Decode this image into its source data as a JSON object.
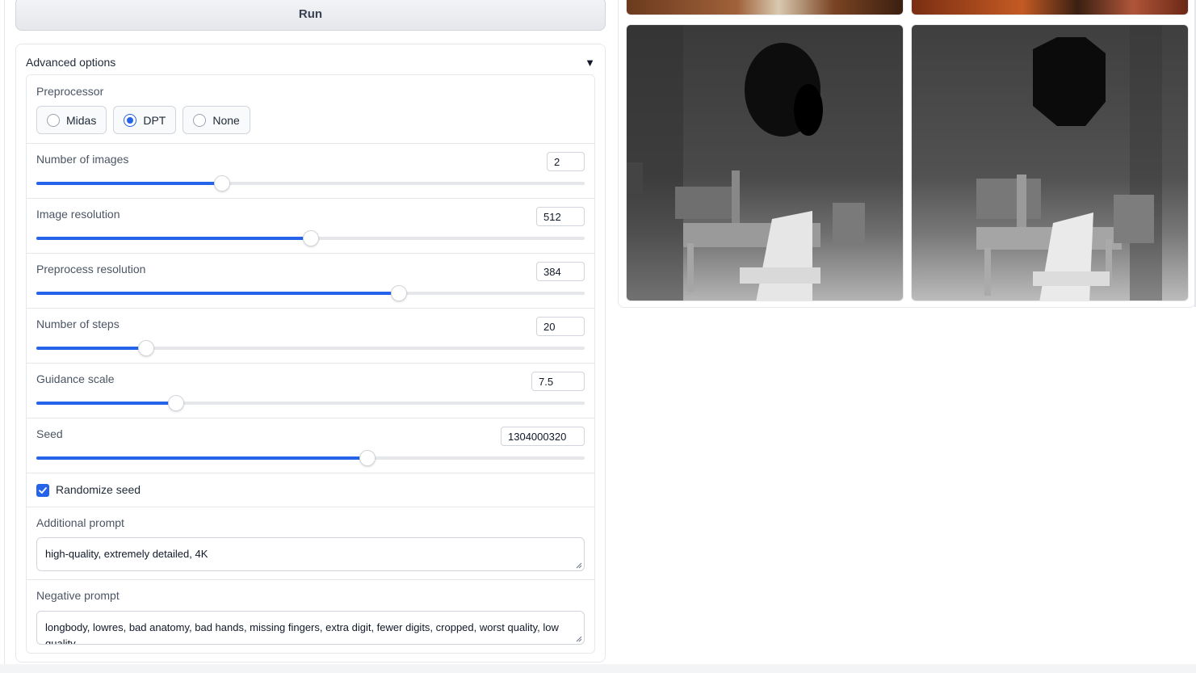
{
  "run_button": {
    "label": "Run"
  },
  "advanced": {
    "title": "Advanced options",
    "caret": "▼",
    "preprocessor": {
      "label": "Preprocessor",
      "options": [
        "Midas",
        "DPT",
        "None"
      ],
      "selected": "DPT"
    },
    "sliders": [
      {
        "label": "Number of images",
        "value": "2",
        "fraction": 0.338
      },
      {
        "label": "Image resolution",
        "value": "512",
        "fraction": 0.5
      },
      {
        "label": "Preprocess resolution",
        "value": "384",
        "fraction": 0.661
      },
      {
        "label": "Number of steps",
        "value": "20",
        "fraction": 0.2
      },
      {
        "label": "Guidance scale",
        "value": "7.5",
        "fraction": 0.255
      },
      {
        "label": "Seed",
        "value": "1304000320",
        "fraction": 0.604
      }
    ],
    "randomize_seed": {
      "label": "Randomize seed",
      "checked": true
    },
    "additional_prompt": {
      "label": "Additional prompt",
      "value": "high-quality, extremely detailed, 4K"
    },
    "negative_prompt": {
      "label": "Negative prompt",
      "value": "longbody, lowres, bad anatomy, bad hands, missing fingers, extra digit, fewer digits, cropped, worst quality, low quality"
    }
  },
  "gallery": {
    "images": [
      "room-photo-1",
      "room-photo-2",
      "depth-map-1",
      "depth-map-2"
    ]
  },
  "colors": {
    "accent": "#2563eb",
    "border": "#e5e7eb"
  }
}
